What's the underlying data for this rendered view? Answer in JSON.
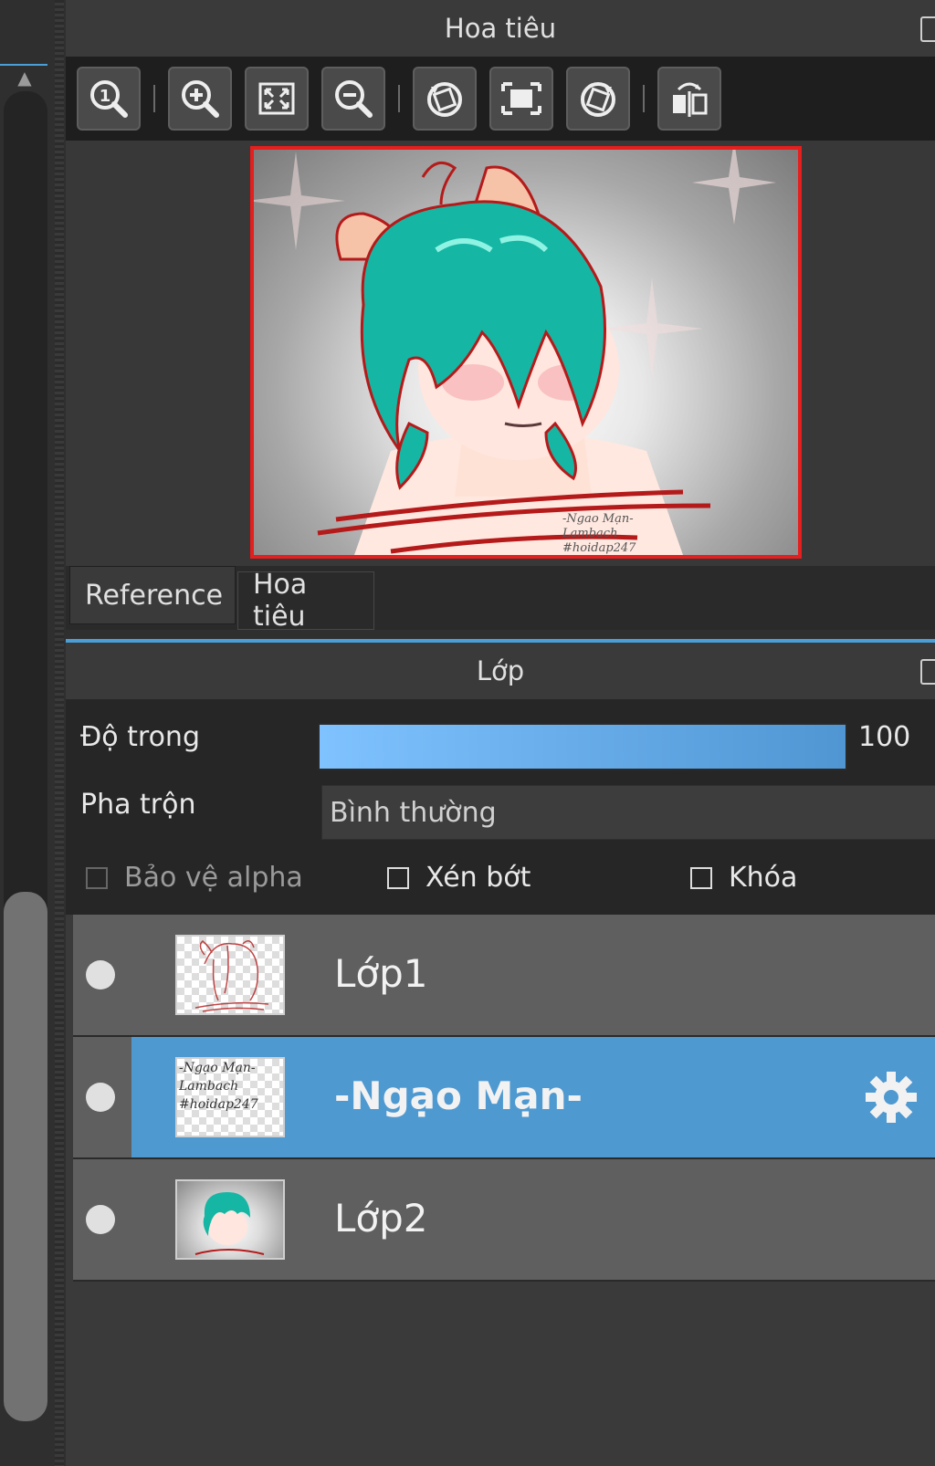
{
  "navigator": {
    "title": "Hoa tiêu",
    "toolbar": [
      {
        "name": "zoom-actual-size",
        "icon": "zoom-1-icon"
      },
      {
        "name": "zoom-in",
        "icon": "zoom-in-icon"
      },
      {
        "name": "fit-to-window",
        "icon": "fit-screen-icon"
      },
      {
        "name": "zoom-out",
        "icon": "zoom-out-icon"
      },
      {
        "name": "rotate-left",
        "icon": "rotate-ccw-icon"
      },
      {
        "name": "reset-view",
        "icon": "frame-icon"
      },
      {
        "name": "rotate-right",
        "icon": "rotate-cw-icon"
      },
      {
        "name": "flip-horizontal",
        "icon": "flip-icon"
      }
    ],
    "preview_signature": [
      "-Ngao Mạn-",
      "Lambach",
      "#hoidap247"
    ],
    "tabs": [
      {
        "label": "Reference",
        "active": false
      },
      {
        "label": "Hoa tiêu",
        "active": true
      }
    ]
  },
  "layers": {
    "title": "Lớp",
    "opacity_label": "Độ trong",
    "opacity_value": "100",
    "opacity_percent": 100,
    "blend_label": "Pha trộn",
    "blend_value": "Bình thường",
    "checks": [
      {
        "label": "Bảo vệ alpha",
        "checked": false,
        "enabled": false
      },
      {
        "label": "Xén bớt",
        "checked": false,
        "enabled": true
      },
      {
        "label": "Khóa",
        "checked": false,
        "enabled": true
      }
    ],
    "items": [
      {
        "name": "Lớp1",
        "selected": false,
        "thumb": "sketch"
      },
      {
        "name": "-Ngạo Mạn-",
        "selected": true,
        "thumb": "text",
        "thumb_lines": [
          "-Ngạo Mạn-",
          "Lambach",
          "#hoidap247"
        ]
      },
      {
        "name": "Lớp2",
        "selected": false,
        "thumb": "art"
      }
    ]
  },
  "colors": {
    "accent": "#4f99d1",
    "frame_border": "#e51e1e",
    "slider_start": "#7fc2ff",
    "slider_end": "#4f96d3"
  }
}
